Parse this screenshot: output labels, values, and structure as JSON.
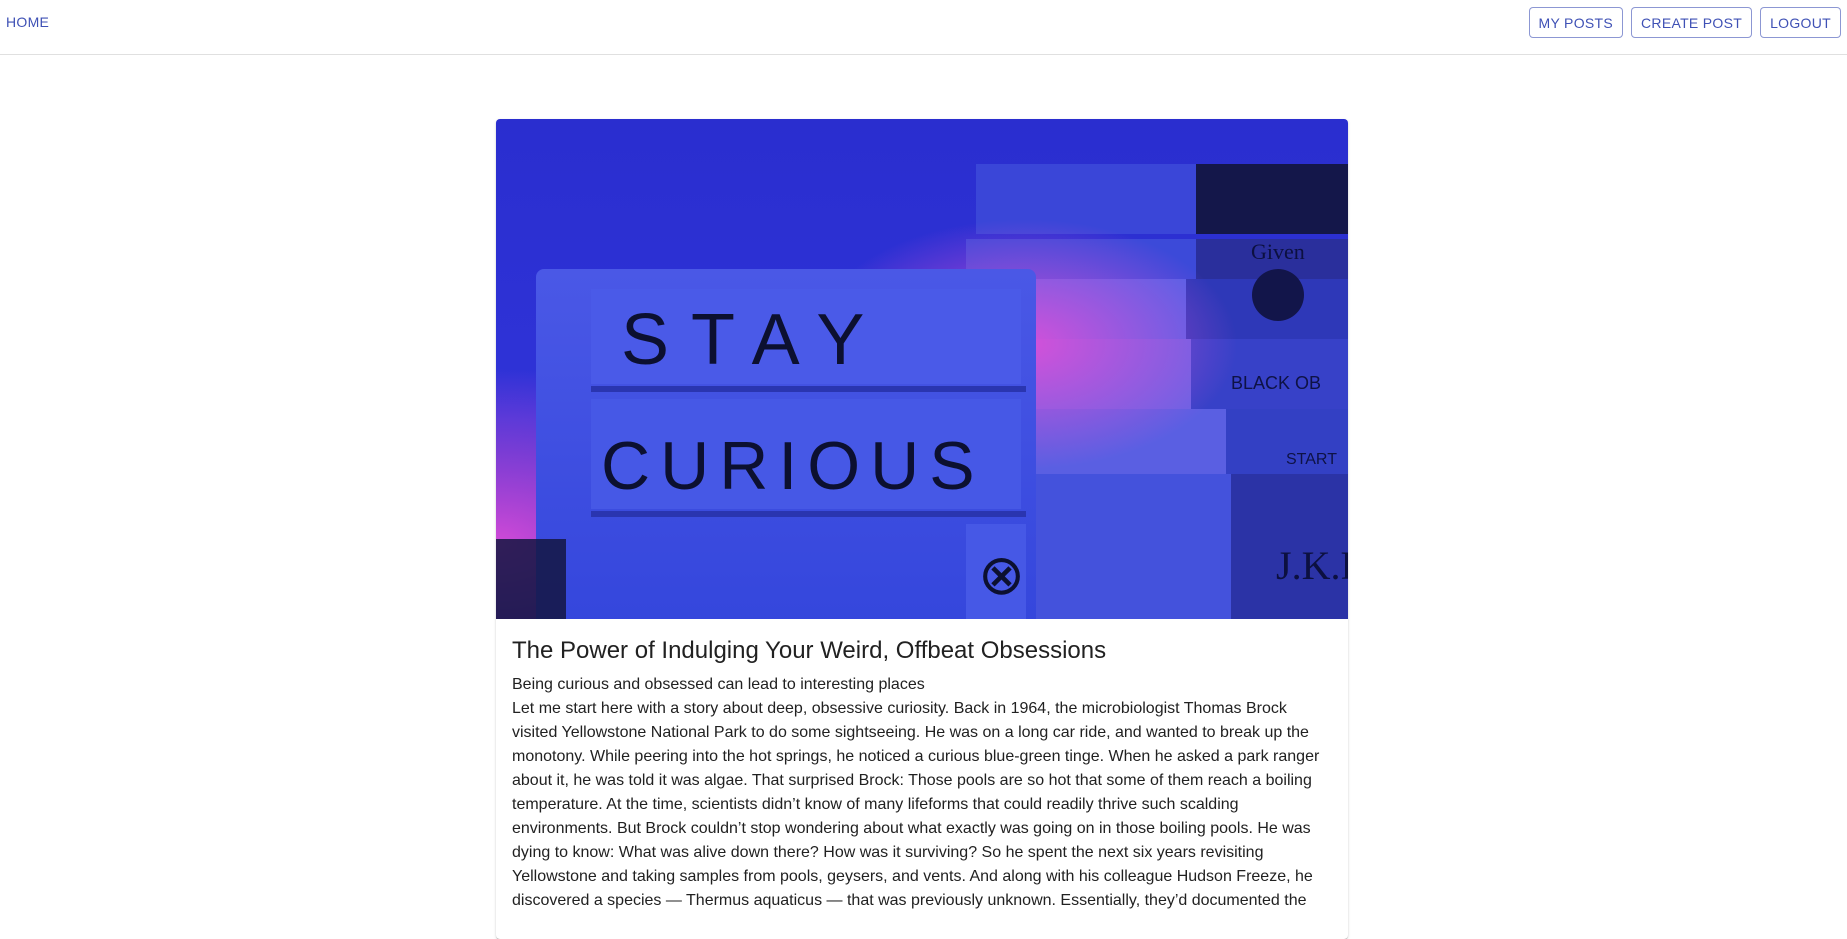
{
  "nav": {
    "home_label": "HOME",
    "my_posts_label": "MY POSTS",
    "create_post_label": "CREATE POST",
    "logout_label": "LOGOUT"
  },
  "post": {
    "title": "The Power of Indulging Your Weird, Offbeat Obsessions",
    "subtitle": "Being curious and obsessed can lead to interesting places",
    "body": "Let me start here with a story about deep, obsessive curiosity. Back in 1964, the microbiologist Thomas Brock visited Yellowstone National Park to do some sightseeing. He was on a long car ride, and wanted to break up the monotony. While peering into the hot springs, he noticed a curious blue-green tinge. When he asked a park ranger about it, he was told it was algae. That surprised Brock: Those pools are so hot that some of them reach a boiling temperature. At the time, scientists didn’t know of many lifeforms that could readily thrive such scalding environments. But Brock couldn’t stop wondering about what exactly was going on in those boiling pools. He was dying to know: What was alive down there? How was it surviving? So he spent the next six years revisiting Yellowstone and taking samples from pools, geysers, and vents. And along with his colleague Hudson Freeze, he discovered a species — Thermus aquaticus — that was previously unknown. Essentially, they’d documented the",
    "image": {
      "lightbox_row1": "STAY",
      "lightbox_row2": "CURIOUS",
      "lightbox_symbol": "⊗",
      "book_spine_1": "Given",
      "book_spine_2": "BLACK OB",
      "book_spine_3": "START",
      "book_spine_4": "J.K.R"
    }
  },
  "colors": {
    "accent": "#3f51b5",
    "image_blue": "#2b2fd6",
    "image_magenta": "#c43ad8"
  }
}
